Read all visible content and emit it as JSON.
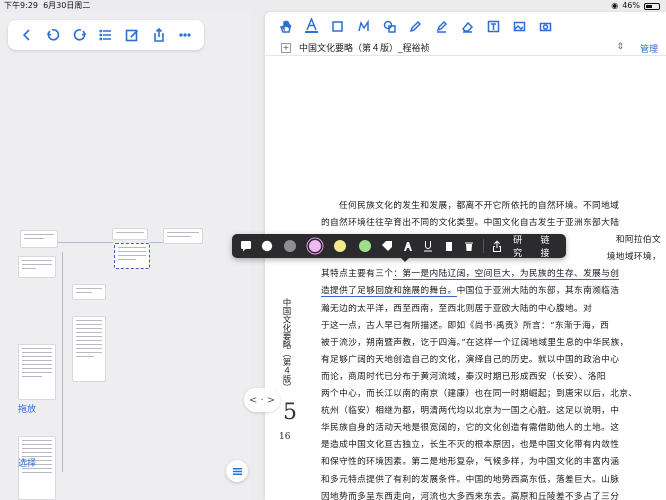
{
  "status_bar": {
    "time": "下午9:29",
    "date": "6月30日周二",
    "battery_percent": "46%",
    "battery_level": 0.46
  },
  "left_toolbar": {
    "icons": [
      "back-icon",
      "undo-icon",
      "redo-icon",
      "list-icon",
      "edit-icon",
      "share-icon",
      "more-icon"
    ]
  },
  "left_panel": {
    "drag_label": "拖放",
    "select_label": "选择"
  },
  "doc_toolbar": {
    "icons": [
      "hand-icon",
      "text-highlight-icon",
      "rectangle-select-icon",
      "lasso-icon",
      "shape-icon",
      "pen-icon",
      "highlighter-icon",
      "eraser-icon",
      "text-box-icon",
      "image-icon",
      "camera-icon"
    ]
  },
  "doc": {
    "title": "中国文化要略（第４版）_程裕祯",
    "sort_symbol": "⇕",
    "manage_label": "管理",
    "vertical_title": "中国文化要略（第４版）",
    "page_number": "16",
    "big_mark": "5",
    "split_handle": "< · >",
    "lines": [
      "任何民族文化的发生和发展，都离不开它所依托的自然环境。不同地域",
      "的自然环境往往孕育出不同的文化类型。中国文化自古发生于亚洲东部大陆",
      "                                                          和阿拉伯文",
      "                                                          境地域环境，",
      "其特点主要有三个：第一是内陆辽阔，空间巨大，为民族的生存、发展与创",
      "造提供了足够回旋和施展的舞台。中国位于亚洲大陆的东部，其东南濒临浩",
      "瀚无边的太平洋，西至西南，至西北则居于亚欧大陆的中心腹地。对",
      "于这一点，古人早已有所描述。即如《尚书·禹贡》所言：“东渐于海，西",
      "被于流沙，朔南暨声教，讫于四海。”在这样一个辽阔地域里生息的中华民族，",
      "有足够广阔的天地创造自己的文化，演绎自己的历史。就以中国的政治中心",
      "而论，商周时代已分布于黄河流域，秦汉时期已形成西安（长安）、洛阳",
      "两个中心，而长江以南的南京（建康）也在同一时期崛起；到唐宋以后，北京、",
      "杭州（临安）相继为都，明清两代均以北京为一国之心脏。这足以说明，中",
      "华民族自身的活动天地是很宽阔的，它的文化创造有需借助他人的土地。这",
      "是造成中国文化亘古独立，长生不灭的根本原因，也是中国文化带有内敛性",
      "和保守性的环境因素。第二是地形复杂，气候多样，为中国文化的丰富内涵",
      "和多元特点提供了有利的发展条件。中国的地势西高东低，落差巨大。山脉",
      "因地势而多呈东西走向，河流也大多西来东去。高原和丘陵差不多占了三分"
    ]
  },
  "context_menu": {
    "icons": [
      "note-icon",
      "palette-icon"
    ],
    "colors": [
      "#8e8e93",
      "#f0b8f4",
      "#f3e98c",
      "#9ede8e"
    ],
    "selected_color": "#f0b8f4",
    "tool_icons": [
      "tag-icon",
      "text-color-icon",
      "underline-icon",
      "copy-icon",
      "trash-icon",
      "share-icon"
    ],
    "research_label": "研究",
    "link_label": "链接"
  }
}
